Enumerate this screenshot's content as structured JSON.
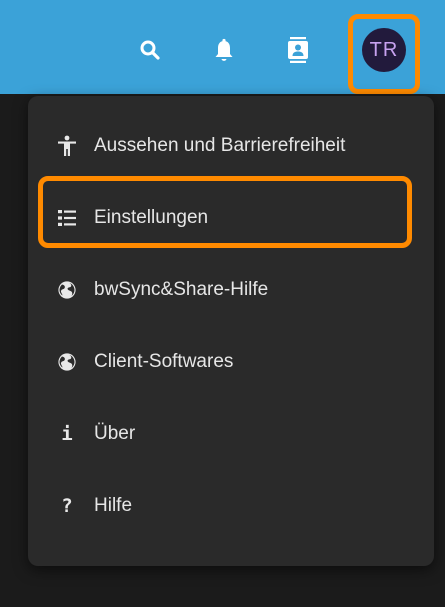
{
  "header": {
    "icons": [
      {
        "name": "search-icon"
      },
      {
        "name": "bell-icon"
      },
      {
        "name": "contacts-icon"
      }
    ],
    "avatar_initials": "TR"
  },
  "menu": {
    "items": [
      {
        "label": "Aussehen und Barrierefreiheit",
        "icon": "accessibility-icon"
      },
      {
        "label": "Einstellungen",
        "icon": "settings-list-icon",
        "highlighted": true
      },
      {
        "label": "bwSync&Share-Hilfe",
        "icon": "globe-icon"
      },
      {
        "label": "Client-Softwares",
        "icon": "globe-icon"
      },
      {
        "label": "Über",
        "icon": "info-icon",
        "glyph": "i"
      },
      {
        "label": "Hilfe",
        "icon": "help-icon",
        "glyph": "?"
      }
    ]
  },
  "colors": {
    "header_bg": "#3ba2d8",
    "menu_bg": "#2a2a2a",
    "highlight": "#ff8a00",
    "avatar_bg": "#221a3c",
    "avatar_text": "#c8a2f0"
  }
}
